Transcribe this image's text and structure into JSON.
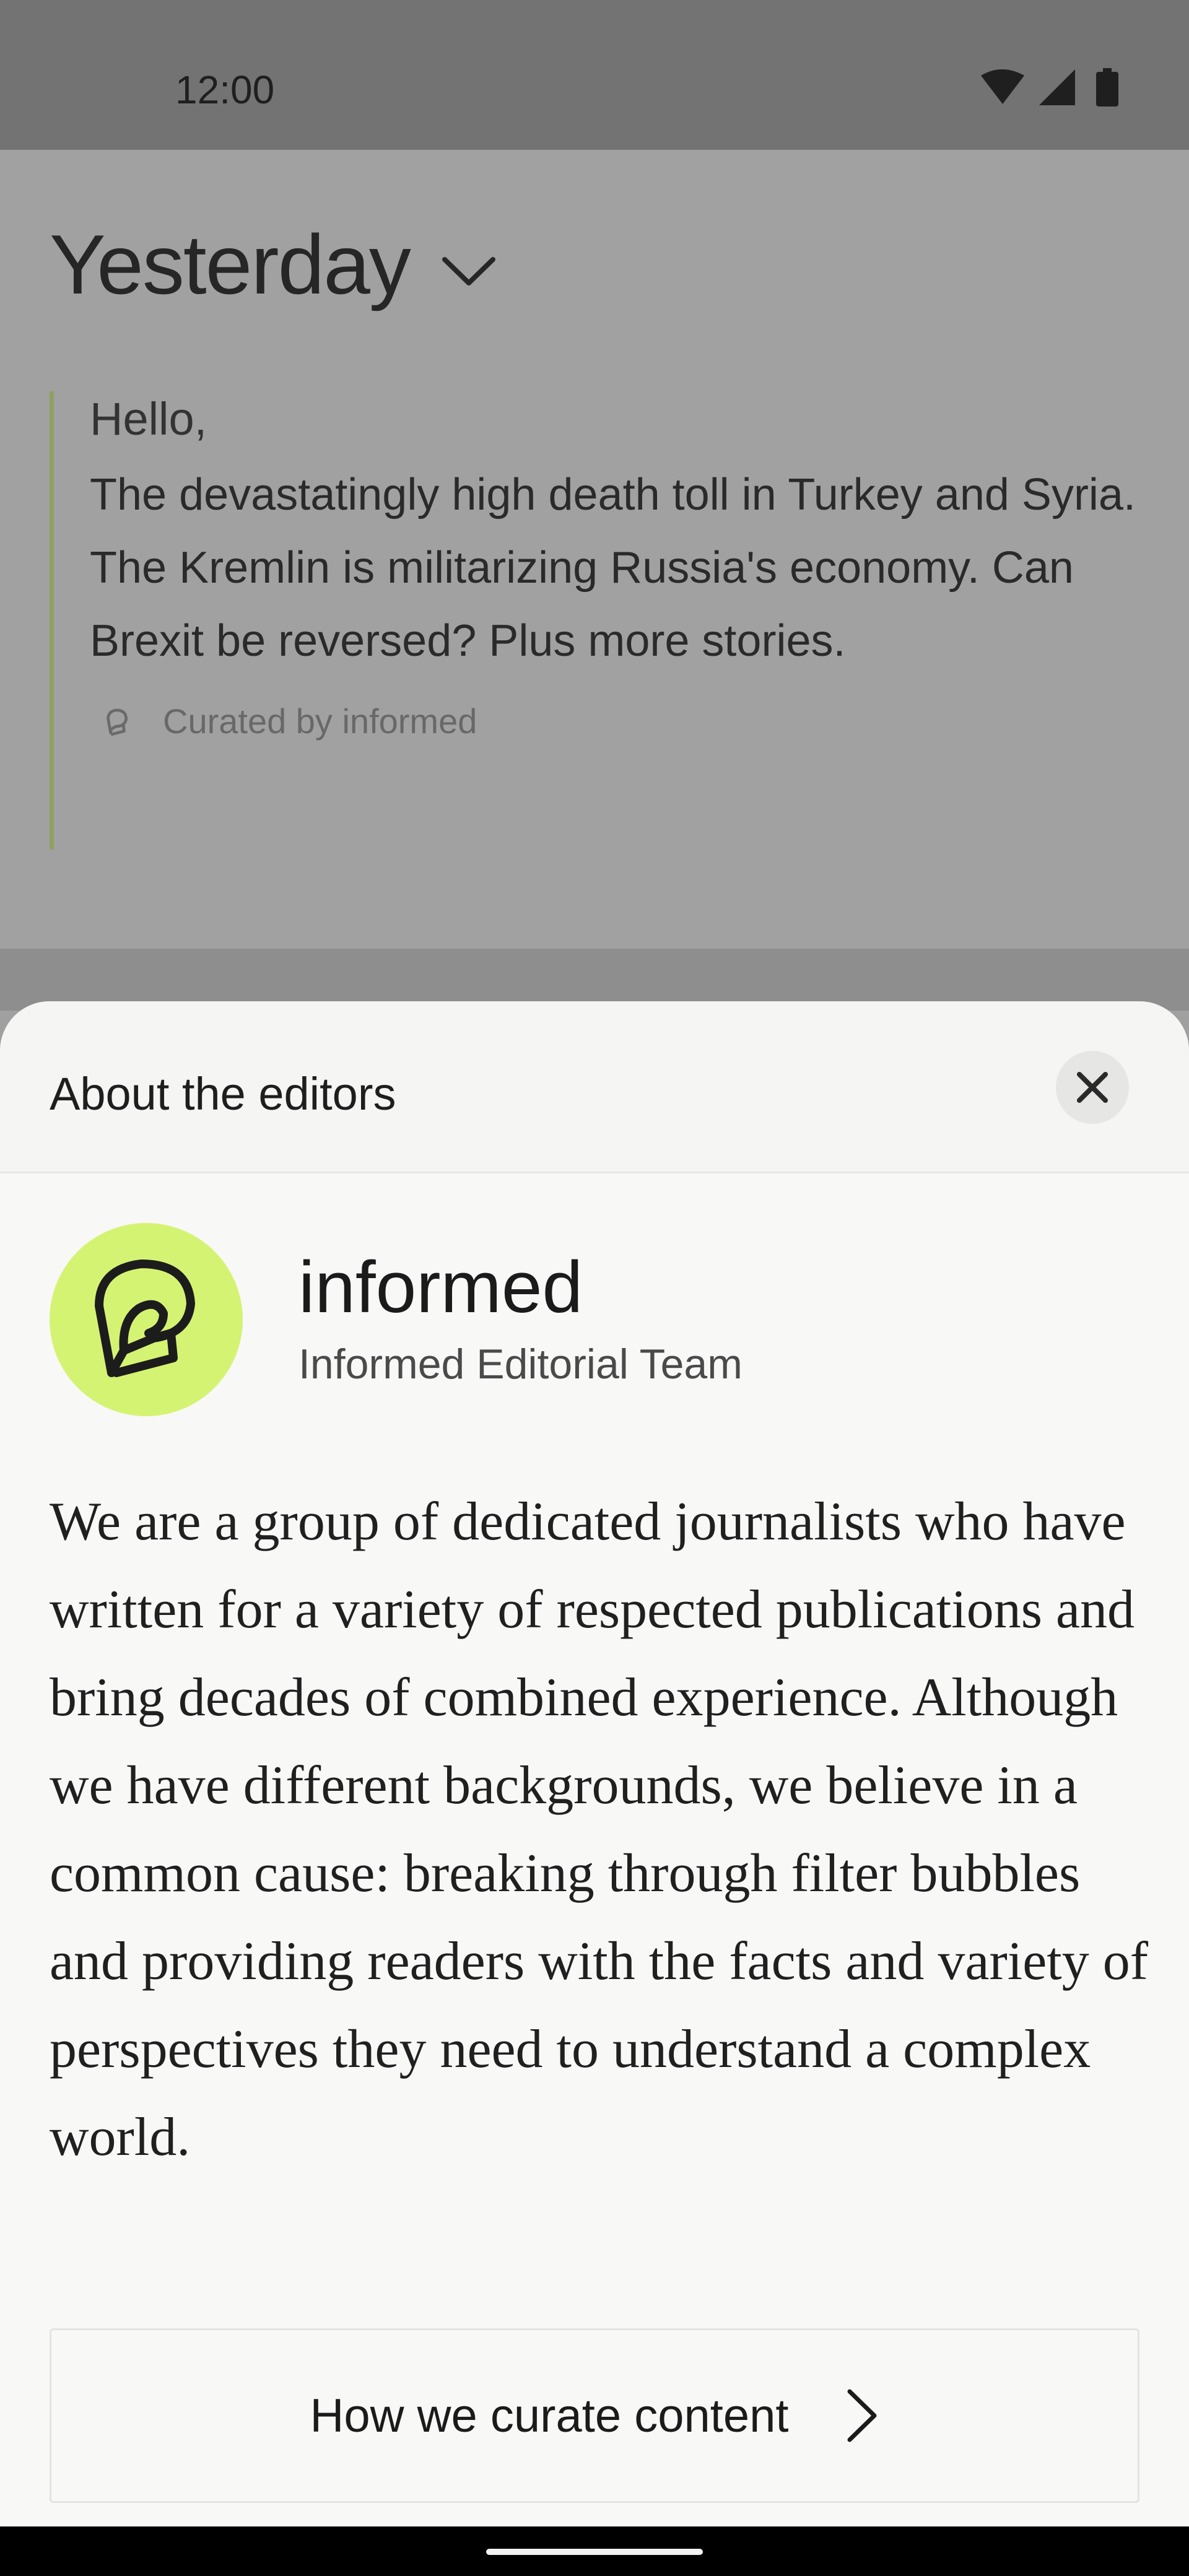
{
  "status_bar": {
    "time": "12:00",
    "icons": [
      "wifi-icon",
      "cellular-signal-icon",
      "battery-icon"
    ]
  },
  "background": {
    "date_title": "Yesterday",
    "date_dropdown_icon": "chevron-down-icon",
    "summary": {
      "greeting": "Hello,",
      "body": "The devastatingly high death toll in Turkey and Syria. The Kremlin is militarizing Russia's economy. Can Brexit be reversed? Plus more stories.",
      "curated_by": "Curated by informed",
      "curated_icon": "informed-logo-icon"
    },
    "accent_color": "#8fa063"
  },
  "sheet": {
    "title": "About the editors",
    "close_icon": "close-icon",
    "editor": {
      "name": "informed",
      "team": "Informed Editorial Team",
      "avatar_icon": "informed-logo-icon",
      "avatar_color": "#d5f373"
    },
    "about": "We are a group of dedicated journalists who have written for a variety of respected publications and bring decades of combined experience. Although we have different backgrounds, we believe in a common cause: breaking through filter bubbles and providing readers with the facts and variety of perspectives they need to understand a complex world.",
    "curate_button": {
      "label": "How we curate content",
      "icon": "chevron-right-icon"
    }
  }
}
